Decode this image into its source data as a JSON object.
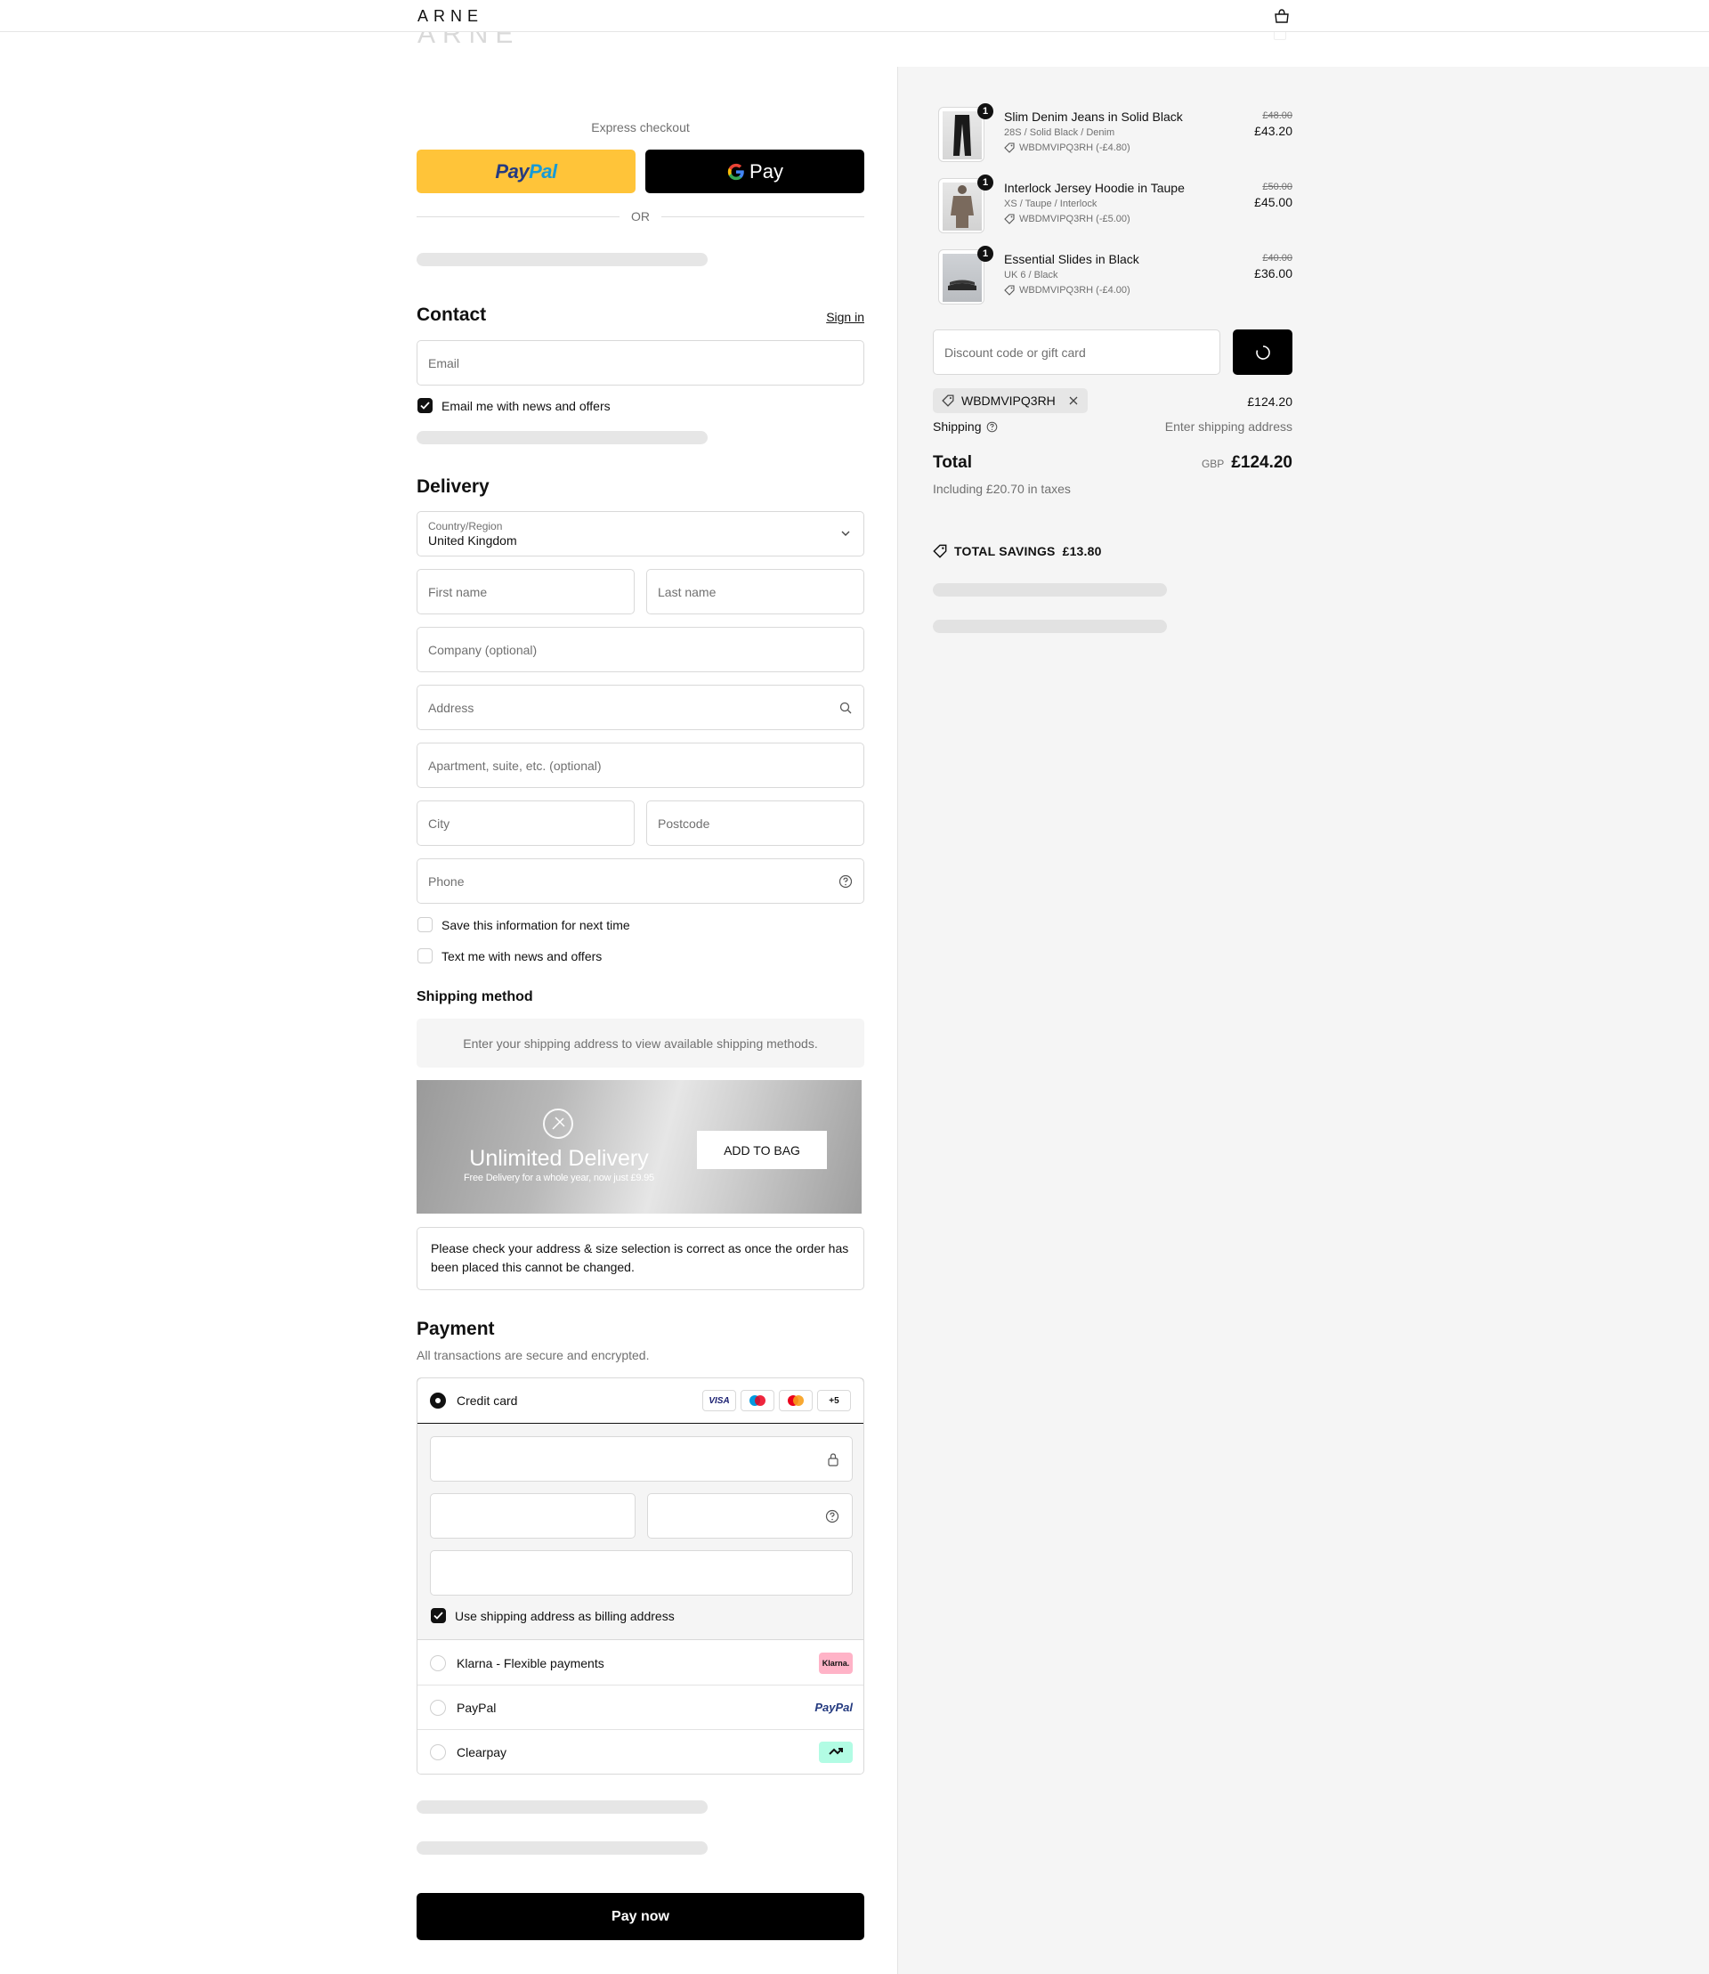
{
  "header": {
    "logo": "ARNE",
    "bag_icon": "bag-icon"
  },
  "express": {
    "title": "Express checkout",
    "paypal_pay": "Pay",
    "paypal_pal": "Pal",
    "gpay_label": "Pay",
    "or": "OR"
  },
  "contact": {
    "title": "Contact",
    "sign_in": "Sign in",
    "email_placeholder": "Email",
    "news_label": "Email me with news and offers",
    "news_checked": true
  },
  "delivery": {
    "title": "Delivery",
    "country_label": "Country/Region",
    "country_value": "United Kingdom",
    "first_name": "First name",
    "last_name": "Last name",
    "company": "Company (optional)",
    "address": "Address",
    "apartment": "Apartment, suite, etc. (optional)",
    "city": "City",
    "postcode": "Postcode",
    "phone": "Phone",
    "save_info": "Save this information for next time",
    "text_me": "Text me with news and offers"
  },
  "shipping": {
    "title": "Shipping method",
    "info": "Enter your shipping address to view available shipping methods."
  },
  "promo": {
    "title": "Unlimited Delivery",
    "subtitle": "Free Delivery for a whole year, now just £9.95",
    "button": "ADD TO BAG"
  },
  "notice": {
    "text": "Please check your address & size selection is correct as once the order has been placed this cannot be changed."
  },
  "payment": {
    "title": "Payment",
    "description": "All transactions are secure and encrypted.",
    "credit_card": "Credit card",
    "card_logos": [
      "VISA",
      "Maestro",
      "Mastercard",
      "+5"
    ],
    "more_cards": "+5",
    "visa": "VISA",
    "billing_label": "Use shipping address as billing address",
    "billing_checked": true,
    "options": [
      {
        "label": "Klarna - Flexible payments",
        "badge": "Klarna."
      },
      {
        "label": "PayPal",
        "badge": "PayPal"
      },
      {
        "label": "Clearpay",
        "badge": "clearpay-icon"
      }
    ],
    "pay_now": "Pay now"
  },
  "summary": {
    "items": [
      {
        "name": "Slim Denim Jeans in Solid Black",
        "variant": "28S / Solid Black / Denim",
        "discount": "WBDMVIPQ3RH (-£4.80)",
        "original_price": "£48.00",
        "price": "£43.20",
        "quantity": "1"
      },
      {
        "name": "Interlock Jersey Hoodie in Taupe",
        "variant": "XS / Taupe / Interlock",
        "discount": "WBDMVIPQ3RH (-£5.00)",
        "original_price": "£50.00",
        "price": "£45.00",
        "quantity": "1"
      },
      {
        "name": "Essential Slides in Black",
        "variant": "UK 6 / Black",
        "discount": "WBDMVIPQ3RH (-£4.00)",
        "original_price": "£40.00",
        "price": "£36.00",
        "quantity": "1"
      }
    ],
    "discount_placeholder": "Discount code or gift card",
    "applied_code": "WBDMVIPQ3RH",
    "subtotal": "£124.20",
    "shipping_label": "Shipping",
    "shipping_value": "Enter shipping address",
    "total_label": "Total",
    "currency": "GBP",
    "total": "£124.20",
    "taxes": "Including £20.70 in taxes",
    "savings_label": "TOTAL SAVINGS",
    "savings_value": "£13.80"
  },
  "colors": {
    "paypal_yellow": "#ffc439",
    "paypal_blue_dark": "#253b80",
    "paypal_blue_light": "#179bd7",
    "klarna_pink": "#ffb3c7",
    "clearpay_mint": "#b2fce4",
    "summary_bg": "#f5f5f5"
  }
}
